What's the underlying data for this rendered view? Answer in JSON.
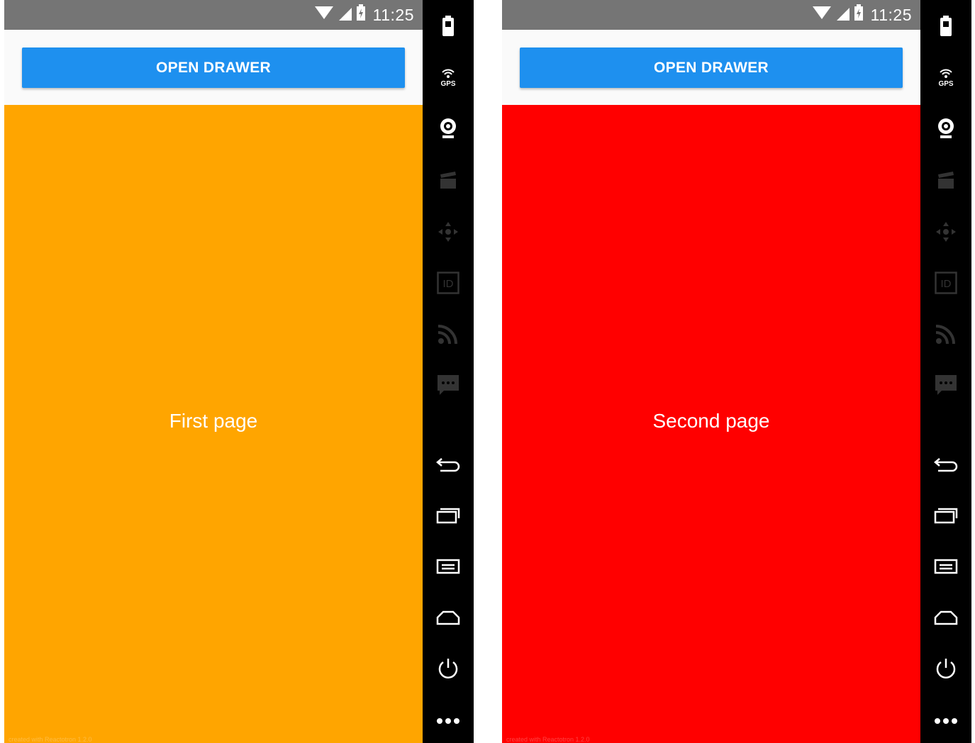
{
  "screens": [
    {
      "status_time": "11:25",
      "button_label": "OPEN DRAWER",
      "page_label": "First page",
      "page_color": "#FFA500",
      "watermark": "created with Reactotron 1.2.0"
    },
    {
      "status_time": "11:25",
      "button_label": "OPEN DRAWER",
      "page_label": "Second page",
      "page_color": "#FF0000",
      "watermark": "created with Reactotron 1.2.0"
    }
  ],
  "colors": {
    "status_bar": "#757575",
    "button": "#1E90EF",
    "toolbar": "#000000",
    "header_bg": "#FAFAFA"
  },
  "toolbar_icons": [
    "battery-icon",
    "gps-icon",
    "webcam-icon",
    "clapperboard-icon",
    "dpad-icon",
    "id-icon",
    "rss-icon",
    "sms-icon",
    "back-icon",
    "recent-apps-icon",
    "menu-icon",
    "home-icon",
    "power-icon",
    "more-icon"
  ],
  "toolbar_text": {
    "gps": "GPS",
    "id": "ID"
  }
}
